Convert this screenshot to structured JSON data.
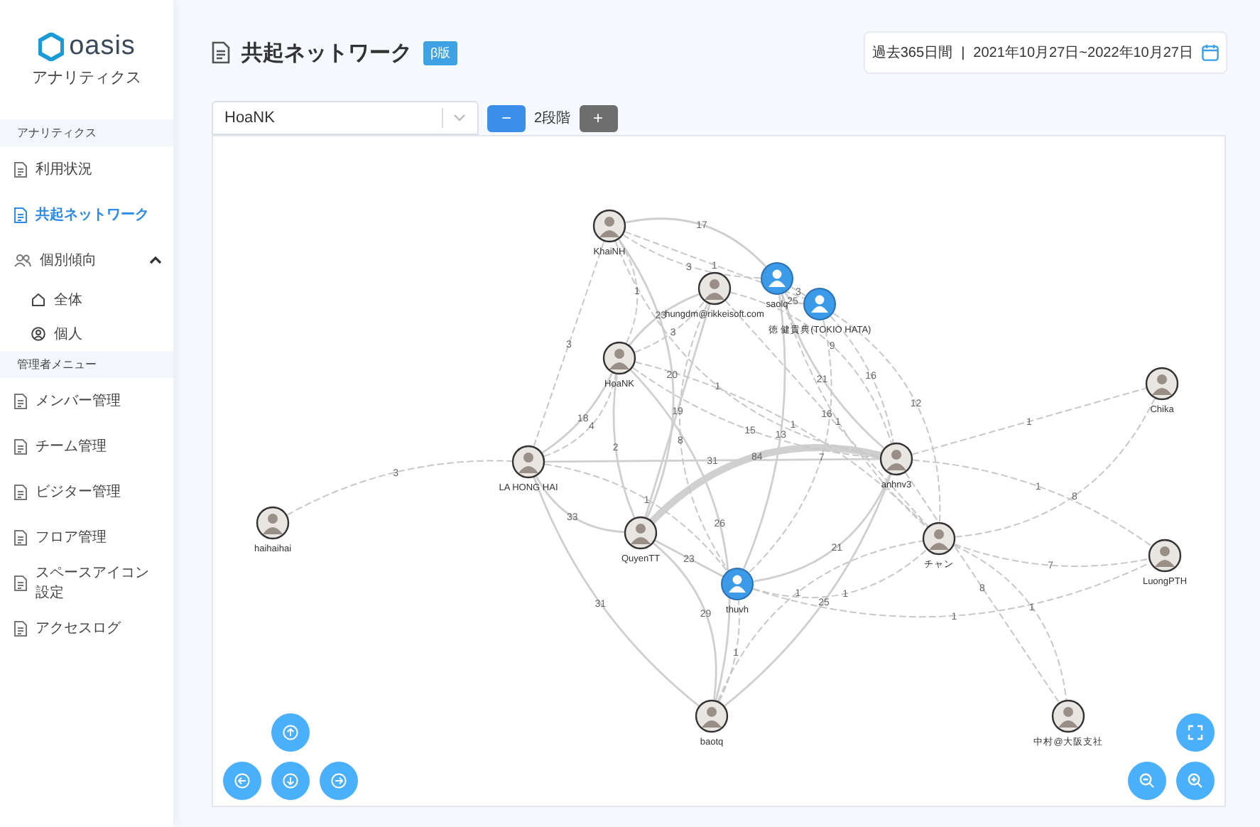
{
  "sidebar": {
    "logo": "oasis",
    "subtitle": "アナリティクス",
    "items": [
      {
        "kind": "heading",
        "label": "アナリティクス"
      },
      {
        "kind": "link",
        "label": "利用状況",
        "selected": false
      },
      {
        "kind": "link",
        "label": "共起ネットワーク",
        "selected": true
      },
      {
        "kind": "group",
        "label": "個別傾向",
        "expanded": true,
        "children": [
          {
            "label": "全体",
            "selected": false
          },
          {
            "label": "個人",
            "selected": false
          }
        ]
      },
      {
        "kind": "heading",
        "label": "管理者メニュー"
      },
      {
        "kind": "link",
        "label": "メンバー管理",
        "selected": false
      },
      {
        "kind": "link",
        "label": "チーム管理",
        "selected": false
      },
      {
        "kind": "link",
        "label": "ビジター管理",
        "selected": false
      },
      {
        "kind": "link",
        "label": "フロア管理",
        "selected": false
      },
      {
        "kind": "link",
        "label": "スペースアイコン設定",
        "selected": false
      },
      {
        "kind": "link",
        "label": "アクセスログ",
        "selected": false
      }
    ]
  },
  "header": {
    "title": "共起ネットワーク",
    "badge": "β版",
    "period": "過去365日間",
    "separator": "|",
    "date_range": "2021年10月27日~2022年10月27日"
  },
  "controls": {
    "member_select": {
      "value": "HoaNK"
    },
    "decrease": "−",
    "depth": "2段階",
    "increase": "+"
  },
  "network": {
    "nodes": [
      {
        "name": "KhaiNH",
        "kind": "photo"
      },
      {
        "name": "hungdm@rikkeisoft.com",
        "kind": "photo"
      },
      {
        "name": "saolq",
        "kind": "user"
      },
      {
        "name": "徳 健貴典(TOKIO HATA)",
        "kind": "user"
      },
      {
        "name": "HoaNK",
        "kind": "photo"
      },
      {
        "name": "LA HONG HAI",
        "kind": "photo"
      },
      {
        "name": "anhnv3",
        "kind": "photo"
      },
      {
        "name": "QuyenTT",
        "kind": "photo"
      },
      {
        "name": "thuvh",
        "kind": "user"
      },
      {
        "name": "チャン",
        "kind": "photo"
      },
      {
        "name": "baotq",
        "kind": "photo"
      },
      {
        "name": "haihaihai",
        "kind": "photo"
      },
      {
        "name": "Chika",
        "kind": "photo"
      },
      {
        "name": "LuongPTH",
        "kind": "photo"
      },
      {
        "name": "中村@大阪支社",
        "kind": "photo"
      }
    ],
    "edges": [
      {
        "label": "84",
        "kind": "heavy"
      },
      {
        "label": "31",
        "kind": "solid"
      },
      {
        "label": "33",
        "kind": "solid"
      },
      {
        "label": "3",
        "kind": "dashed"
      },
      {
        "label": "31",
        "kind": "solid"
      },
      {
        "label": "29",
        "kind": "solid"
      },
      {
        "label": "23",
        "kind": "solid"
      },
      {
        "label": "21",
        "kind": "solid"
      },
      {
        "label": "25",
        "kind": "solid"
      },
      {
        "label": "1",
        "kind": "dashed"
      },
      {
        "label": "1",
        "kind": "dashed"
      },
      {
        "label": "1",
        "kind": "dashed"
      },
      {
        "label": "1",
        "kind": "dashed"
      },
      {
        "label": "1",
        "kind": "dashed"
      },
      {
        "label": "2",
        "kind": "solid"
      },
      {
        "label": "20",
        "kind": "solid"
      },
      {
        "label": "3",
        "kind": "dashed"
      },
      {
        "label": "4",
        "kind": "dashed"
      },
      {
        "label": "18",
        "kind": "solid"
      },
      {
        "label": "15",
        "kind": "dashed"
      },
      {
        "label": "26",
        "kind": "solid"
      },
      {
        "label": "19",
        "kind": "solid"
      },
      {
        "label": "8",
        "kind": "dashed"
      },
      {
        "label": "13",
        "kind": "solid"
      },
      {
        "label": "23",
        "kind": "solid"
      },
      {
        "label": "17",
        "kind": "solid"
      },
      {
        "label": "1",
        "kind": "dashed"
      },
      {
        "label": "1",
        "kind": "dashed"
      },
      {
        "label": "3",
        "kind": "dashed"
      },
      {
        "label": "3",
        "kind": "dashed"
      },
      {
        "label": "9",
        "kind": "dashed"
      },
      {
        "label": "3",
        "kind": "dashed"
      },
      {
        "label": "25",
        "kind": "solid"
      },
      {
        "label": "16",
        "kind": "dashed"
      },
      {
        "label": "21",
        "kind": "solid"
      },
      {
        "label": "12",
        "kind": "dashed"
      },
      {
        "label": "16",
        "kind": "dashed"
      },
      {
        "label": "1",
        "kind": "dashed"
      },
      {
        "label": "1",
        "kind": "dashed"
      },
      {
        "label": "1",
        "kind": "dashed"
      },
      {
        "label": "7",
        "kind": "dashed"
      },
      {
        "label": "1",
        "kind": "dashed"
      },
      {
        "label": "8",
        "kind": "dashed"
      },
      {
        "label": "1",
        "kind": "dashed"
      },
      {
        "label": "7",
        "kind": "dashed"
      },
      {
        "label": "1",
        "kind": "dashed"
      },
      {
        "label": "8",
        "kind": "dashed"
      }
    ]
  }
}
